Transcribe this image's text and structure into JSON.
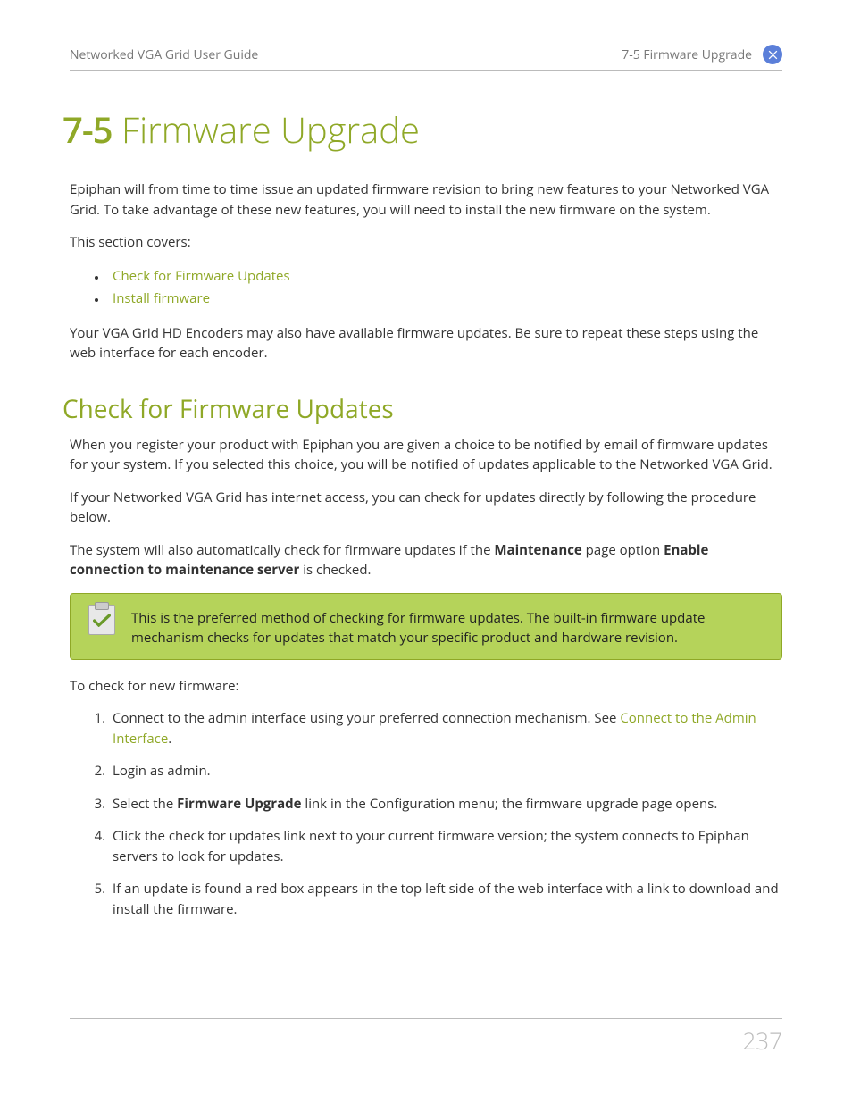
{
  "header": {
    "left": "Networked VGA Grid User Guide",
    "right": "7-5 Firmware Upgrade"
  },
  "title": {
    "number": "7-5",
    "text": "Firmware Upgrade"
  },
  "intro": "Epiphan will from time to time issue an updated firmware revision to bring new features to your Networked VGA Grid. To take advantage of these new features, you will need to install the new firmware on the system.",
  "section_covers_label": "This section covers:",
  "toc": [
    "Check for Firmware Updates",
    "Install firmware"
  ],
  "encoder_note": "Your VGA Grid HD Encoders may also have available firmware updates. Be sure to repeat these steps using the web interface for each encoder.",
  "h2_check": "Check for Firmware Updates",
  "check_p1": "When you register your product with Epiphan you are given a choice to be notified by email of firmware updates for your system. If you selected this choice, you will be notified of updates applicable to the Networked VGA Grid.",
  "check_p2": "If your Networked VGA Grid has internet access, you can check for updates directly by following the procedure below.",
  "check_p3_pre": "The system will also automatically check for firmware updates if the ",
  "check_p3_b1": "Maintenance",
  "check_p3_mid": " page option ",
  "check_p3_b2": "Enable connection to maintenance server",
  "check_p3_post": " is checked.",
  "callout": "This is the preferred method of checking for firmware updates. The built-in firmware update mechanism checks for updates that match your specific product and hardware revision.",
  "to_check_label": "To check for new firmware:",
  "steps": {
    "s1_pre": "Connect to the admin interface using your preferred connection mechanism. See ",
    "s1_link": "Connect to the Admin Interface",
    "s1_post": ".",
    "s2": "Login as admin.",
    "s3_pre": "Select the ",
    "s3_bold": "Firmware Upgrade",
    "s3_post": " link in the Configuration menu; the firmware upgrade page opens.",
    "s4": "Click the check for updates link next to your current firmware version; the system connects to Epiphan servers to look for updates.",
    "s5": "If an update is found a red box appears in the top left side of the web interface with a link to download and install the firmware."
  },
  "page_number": "237"
}
